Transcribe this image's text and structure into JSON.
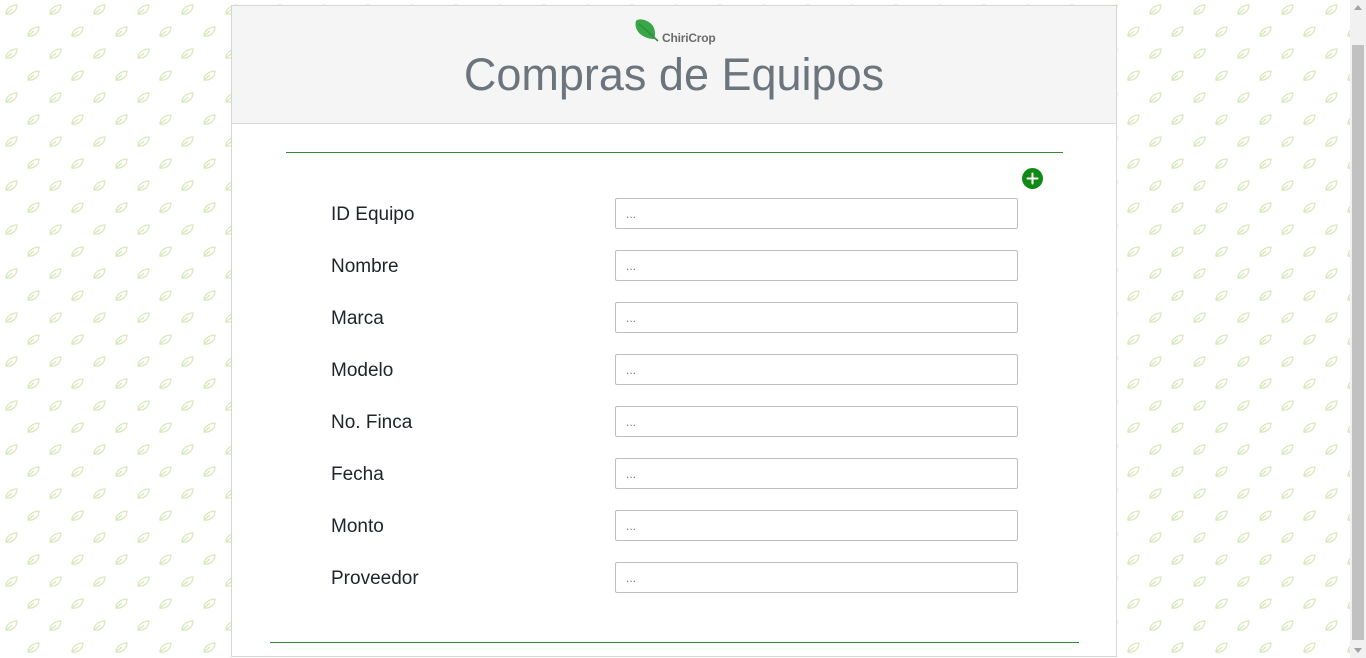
{
  "brand": {
    "name": "ChiriCrop",
    "logo_icon": "leaf-icon",
    "accent_color": "#3aa64a"
  },
  "page": {
    "title": "Compras de Equipos"
  },
  "toolbar": {
    "add_icon": "plus-circle-icon",
    "add_color": "#0f8a14"
  },
  "form": {
    "fields": [
      {
        "label": "ID Equipo",
        "placeholder": "..."
      },
      {
        "label": "Nombre",
        "placeholder": "..."
      },
      {
        "label": "Marca",
        "placeholder": "..."
      },
      {
        "label": "Modelo",
        "placeholder": "..."
      },
      {
        "label": "No. Finca",
        "placeholder": "..."
      },
      {
        "label": "Fecha",
        "placeholder": "..."
      },
      {
        "label": "Monto",
        "placeholder": "..."
      },
      {
        "label": "Proveedor",
        "placeholder": "..."
      }
    ]
  },
  "background": {
    "pattern_icon": "leaf-outline-icon",
    "pattern_color": "#d6e6b4"
  }
}
